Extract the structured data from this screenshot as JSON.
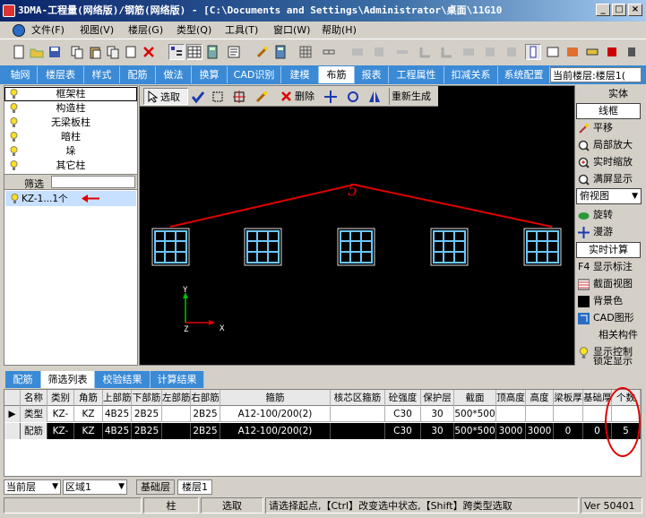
{
  "window": {
    "title": "3DMA-工程量(网络版)/钢筋(网络版) - [C:\\Documents and Settings\\Administrator\\桌面\\11G10",
    "btn_min": "_",
    "btn_max": "□",
    "btn_close": "×"
  },
  "menu": {
    "items": [
      "文件(F)",
      "视图(V)",
      "楼层(G)",
      "类型(Q)",
      "工具(T)",
      "窗口(W)",
      "帮助(H)"
    ]
  },
  "tabs": {
    "items": [
      "轴网",
      "楼层表",
      "样式",
      "配筋",
      "做法",
      "换算",
      "CAD识别",
      "建模",
      "布筋",
      "报表",
      "工程属性",
      "扣减关系",
      "系统配置"
    ],
    "active": "布筋",
    "current_floor": "当前楼层:楼层1("
  },
  "left_panel": {
    "categories": [
      "框架柱",
      "构造柱",
      "无梁板柱",
      "暗柱",
      "垛",
      "其它柱"
    ],
    "filter_label": "筛选",
    "filter_item": "KZ-1...1个"
  },
  "canvas_toolbar": {
    "select": "选取",
    "delete": "删除",
    "regenerate": "重新生成"
  },
  "canvas": {
    "annotation": "5",
    "axis_y": "Y",
    "axis_x": "X",
    "axis_z": "Z"
  },
  "right_panel": {
    "entity": "实体",
    "wireframe": "线框",
    "pan": "平移",
    "zoom_local": "局部放大",
    "zoom_realtime": "实时缩放",
    "zoom_full": "满屏显示",
    "view_select": "俯视图",
    "rotate": "旋转",
    "roam": "漫游",
    "realtime_calc": "实时计算",
    "show_label": "F4 显示标注",
    "section_view": "截面视图",
    "bg_color": "背景色",
    "cad_graphic": "CAD图形",
    "related": "相关构件",
    "display_ctrl": "显示控制",
    "lock_display": "锁定显示"
  },
  "bottom_tabs": {
    "items": [
      "配筋",
      "筛选列表",
      "校验结果",
      "计算结果"
    ],
    "active": "筛选列表"
  },
  "grid": {
    "headers": [
      "名称",
      "类别",
      "角筋",
      "上部筋",
      "下部筋",
      "左部筋",
      "右部筋",
      "箍筋",
      "核芯区箍筋",
      "砼强度",
      "保护层",
      "截面",
      "顶高度",
      "高度",
      "梁板厚",
      "基础厚",
      "个数"
    ],
    "rows": [
      {
        "label": "类型",
        "cells": [
          "KZ-",
          "KZ",
          "4B25",
          "2B25",
          "",
          "2B25",
          "",
          "A12-100/200(2)",
          "",
          "C30",
          "30",
          "500*500",
          "",
          "",
          "",
          "",
          ""
        ]
      },
      {
        "label": "配筋",
        "cells": [
          "KZ-",
          "KZ",
          "4B25",
          "2B25",
          "",
          "2B25",
          "",
          "A12-100/200(2)",
          "",
          "C30",
          "30",
          "500*500",
          "3000",
          "3000",
          "0",
          "0",
          "5"
        ]
      }
    ]
  },
  "floor_bar": {
    "current": "当前层",
    "region": "区域1",
    "tabs": [
      "基础层",
      "楼层1"
    ]
  },
  "status": {
    "type": "柱",
    "action": "选取",
    "hint": "请选择起点,【Ctrl】改变选中状态,【Shift】跨类型选取",
    "version": "Ver 50401"
  },
  "colors": {
    "accent_tab": "#3a8ad6",
    "annotation": "#e00000",
    "window_frame": "#6cc6ff"
  }
}
